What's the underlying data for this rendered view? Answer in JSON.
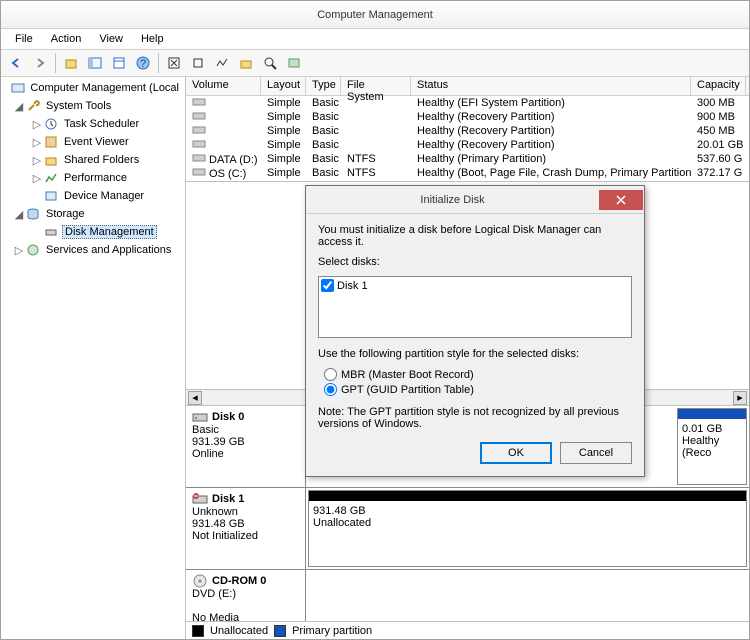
{
  "window": {
    "title": "Computer Management"
  },
  "menu": {
    "file": "File",
    "action": "Action",
    "view": "View",
    "help": "Help"
  },
  "tree": {
    "root": "Computer Management (Local",
    "systools": "System Tools",
    "task": "Task Scheduler",
    "event": "Event Viewer",
    "shared": "Shared Folders",
    "perf": "Performance",
    "devmgr": "Device Manager",
    "storage": "Storage",
    "diskmgmt": "Disk Management",
    "services": "Services and Applications"
  },
  "cols": {
    "volume": "Volume",
    "layout": "Layout",
    "type": "Type",
    "fs": "File System",
    "status": "Status",
    "capacity": "Capacity"
  },
  "vols": [
    {
      "name": "",
      "layout": "Simple",
      "type": "Basic",
      "fs": "",
      "status": "Healthy (EFI System Partition)",
      "cap": "300 MB"
    },
    {
      "name": "",
      "layout": "Simple",
      "type": "Basic",
      "fs": "",
      "status": "Healthy (Recovery Partition)",
      "cap": "900 MB"
    },
    {
      "name": "",
      "layout": "Simple",
      "type": "Basic",
      "fs": "",
      "status": "Healthy (Recovery Partition)",
      "cap": "450 MB"
    },
    {
      "name": "",
      "layout": "Simple",
      "type": "Basic",
      "fs": "",
      "status": "Healthy (Recovery Partition)",
      "cap": "20.01 GB"
    },
    {
      "name": "DATA (D:)",
      "layout": "Simple",
      "type": "Basic",
      "fs": "NTFS",
      "status": "Healthy (Primary Partition)",
      "cap": "537.60 G"
    },
    {
      "name": "OS (C:)",
      "layout": "Simple",
      "type": "Basic",
      "fs": "NTFS",
      "status": "Healthy (Boot, Page File, Crash Dump, Primary Partition)",
      "cap": "372.17 G"
    }
  ],
  "disks": {
    "d0": {
      "title": "Disk 0",
      "l1": "Basic",
      "l2": "931.39 GB",
      "l3": "Online",
      "pcap": "0.01 GB",
      "pst": "Healthy (Reco"
    },
    "d1": {
      "title": "Disk 1",
      "l1": "Unknown",
      "l2": "931.48 GB",
      "l3": "Not Initialized",
      "pcap": "931.48 GB",
      "pst": "Unallocated"
    },
    "cd": {
      "title": "CD-ROM 0",
      "l1": "DVD (E:)",
      "l3": "No Media"
    }
  },
  "legend": {
    "unalloc": "Unallocated",
    "primary": "Primary partition"
  },
  "dialog": {
    "title": "Initialize Disk",
    "msg": "You must initialize a disk before Logical Disk Manager can access it.",
    "sel": "Select disks:",
    "disk1": "Disk 1",
    "use": "Use the following partition style for the selected disks:",
    "mbr": "MBR (Master Boot Record)",
    "gpt": "GPT (GUID Partition Table)",
    "note": "Note: The GPT partition style is not recognized by all previous versions of Windows.",
    "ok": "OK",
    "cancel": "Cancel"
  }
}
